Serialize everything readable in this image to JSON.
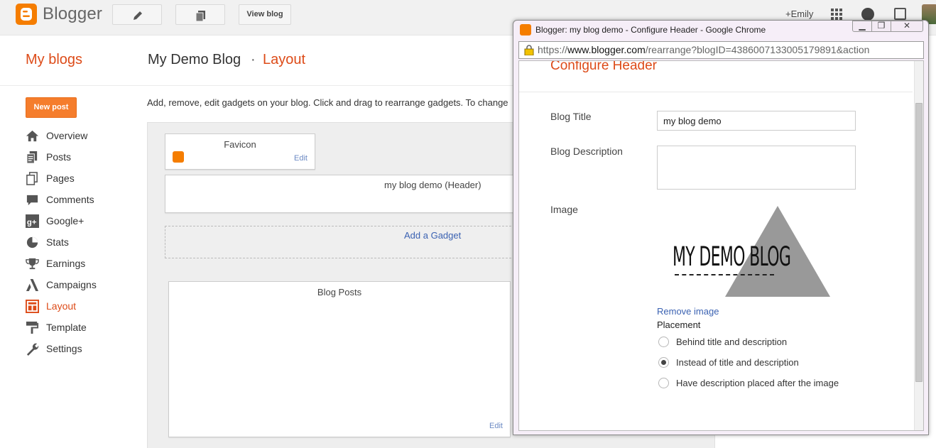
{
  "topbar": {
    "app_name": "Blogger",
    "view_blog_label": "View blog",
    "user_label": "+Emily"
  },
  "header": {
    "my_blogs": "My blogs",
    "blog_name": "My Demo Blog",
    "separator": "·",
    "section": "Layout"
  },
  "sidebar": {
    "new_post": "New post",
    "items": [
      {
        "label": "Overview",
        "icon": "home-icon"
      },
      {
        "label": "Posts",
        "icon": "posts-icon"
      },
      {
        "label": "Pages",
        "icon": "pages-icon"
      },
      {
        "label": "Comments",
        "icon": "comments-icon"
      },
      {
        "label": "Google+",
        "icon": "google-plus-icon"
      },
      {
        "label": "Stats",
        "icon": "stats-icon"
      },
      {
        "label": "Earnings",
        "icon": "trophy-icon"
      },
      {
        "label": "Campaigns",
        "icon": "campaigns-icon"
      },
      {
        "label": "Layout",
        "icon": "layout-icon",
        "active": true
      },
      {
        "label": "Template",
        "icon": "template-icon"
      },
      {
        "label": "Settings",
        "icon": "wrench-icon"
      }
    ]
  },
  "main": {
    "intro": "Add, remove, edit gadgets on your blog. Click and drag to rearrange gadgets. To change",
    "favicon_title": "Favicon",
    "favicon_edit": "Edit",
    "header_gadget_title": "my blog demo (Header)",
    "add_gadget": "Add a Gadget",
    "blog_posts_title": "Blog Posts",
    "blog_posts_edit": "Edit"
  },
  "popup": {
    "window_title": "Blogger: my blog demo - Configure Header - Google Chrome",
    "url_scheme": "https://",
    "url_host": "www.blogger.com",
    "url_path": "/rearrange?blogID=4386007133005179891&action",
    "heading": "Configure Header",
    "blog_title_label": "Blog Title",
    "blog_title_value": "my blog demo",
    "blog_description_label": "Blog Description",
    "blog_description_value": "",
    "image_label": "Image",
    "header_image_text": "MY DEMO BLOG",
    "remove_image": "Remove image",
    "placement_label": "Placement",
    "placement_options": [
      {
        "label": "Behind title and description",
        "selected": false
      },
      {
        "label": "Instead of title and description",
        "selected": true
      },
      {
        "label": "Have description placed after the image",
        "selected": false
      }
    ]
  },
  "colors": {
    "brand_orange": "#f57d00",
    "accent_orange": "#dd4b18",
    "link_blue": "#3b62b2"
  }
}
